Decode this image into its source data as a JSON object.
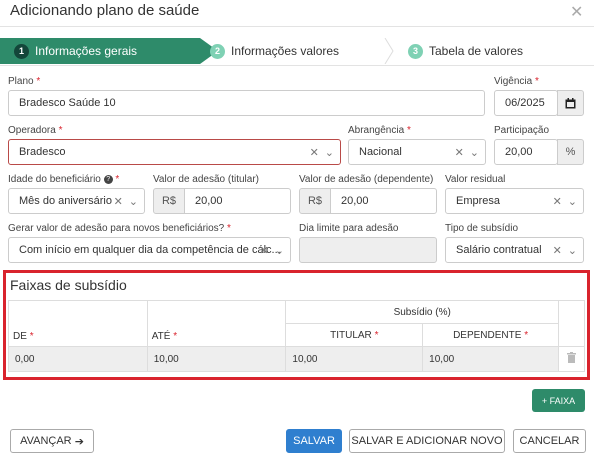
{
  "modal": {
    "title": "Adicionando plano de saúde"
  },
  "steps": [
    {
      "num": "1",
      "label": "Informações gerais"
    },
    {
      "num": "2",
      "label": "Informações valores"
    },
    {
      "num": "3",
      "label": "Tabela de valores"
    }
  ],
  "form": {
    "plano": {
      "label": "Plano",
      "value": "Bradesco Saúde 10"
    },
    "vigencia": {
      "label": "Vigência",
      "value": "06/2025"
    },
    "operadora": {
      "label": "Operadora",
      "value": "Bradesco"
    },
    "abrangencia": {
      "label": "Abrangência",
      "value": "Nacional"
    },
    "participacao": {
      "label": "Participação",
      "value": "20,00",
      "suffix": "%"
    },
    "idade": {
      "label": "Idade do beneficiário",
      "value": "Mês do aniversário"
    },
    "adesao_titular": {
      "label": "Valor de adesão (titular)",
      "prefix": "R$",
      "value": "20,00"
    },
    "adesao_dependente": {
      "label": "Valor de adesão (dependente)",
      "prefix": "R$",
      "value": "20,00"
    },
    "residual": {
      "label": "Valor residual",
      "value": "Empresa"
    },
    "gerar": {
      "label": "Gerar valor de adesão para novos beneficiários?",
      "value": "Com início em qualquer dia da competência de cálc..."
    },
    "dia_limite": {
      "label": "Dia limite para adesão",
      "value": ""
    },
    "tipo_subsidio": {
      "label": "Tipo de subsídio",
      "value": "Salário contratual"
    }
  },
  "faixas": {
    "title": "Faixas de subsídio",
    "group_header": "Subsídio (%)",
    "columns": {
      "de": "DE",
      "ate": "ATÉ",
      "titular": "TITULAR",
      "dependente": "DEPENDENTE"
    },
    "rows": [
      {
        "de": "0,00",
        "ate": "10,00",
        "titular": "10,00",
        "dependente": "10,00"
      }
    ]
  },
  "buttons": {
    "add_faixa": "+ FAIXA",
    "avancar": "AVANÇAR",
    "salvar": "SALVAR",
    "salvar_adicionar": "SALVAR E ADICIONAR NOVO",
    "cancelar": "CANCELAR"
  }
}
